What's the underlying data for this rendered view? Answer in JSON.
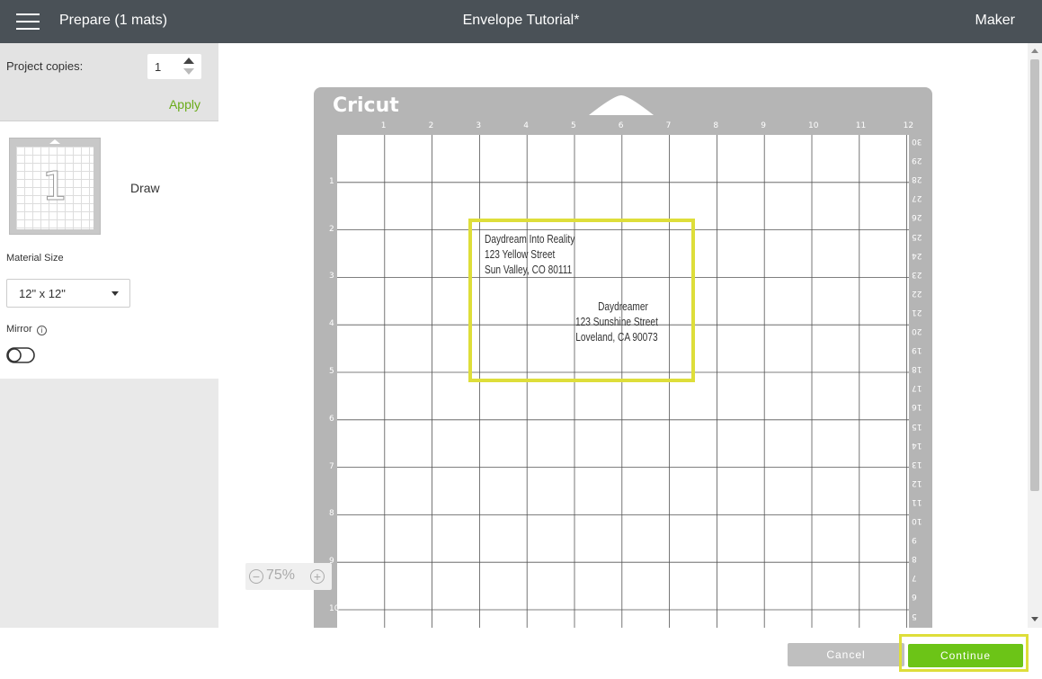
{
  "header": {
    "prepare": "Prepare (1 mats)",
    "project_title": "Envelope Tutorial*",
    "machine": "Maker"
  },
  "sidebar": {
    "copies_label": "Project copies:",
    "copies_value": "1",
    "apply": "Apply",
    "mat_number": "1",
    "mat_mode": "Draw",
    "material_size_label": "Material Size",
    "material_size_value": "12\" x 12\"",
    "mirror_label": "Mirror",
    "mirror_info_glyph": "i",
    "mirror_on": false
  },
  "mat": {
    "brand": "Cricut",
    "top_ruler": [
      "1",
      "2",
      "3",
      "4",
      "5",
      "6",
      "7",
      "8",
      "9",
      "10",
      "11",
      "12"
    ],
    "left_ruler": [
      "1",
      "2",
      "3",
      "4",
      "5",
      "6",
      "7",
      "8",
      "9",
      "10"
    ],
    "right_ruler": [
      "30",
      "29",
      "28",
      "27",
      "26",
      "25",
      "24",
      "23",
      "22",
      "21",
      "20",
      "19",
      "18",
      "17",
      "16",
      "15",
      "14",
      "13",
      "12",
      "11",
      "10",
      "9",
      "8",
      "7",
      "6",
      "5"
    ],
    "return_address": [
      "Daydream Into Reality",
      "123 Yellow Street",
      "Sun Valley, CO 80111"
    ],
    "recipient_address": [
      "Daydreamer",
      "123 Sunshine Street",
      "Loveland, CA 90073"
    ]
  },
  "zoom": {
    "minus": "−",
    "value": "75%",
    "plus": "+"
  },
  "footer": {
    "cancel": "Cancel",
    "continue": "Continue"
  },
  "colors": {
    "header": "#4a5157",
    "accent_green": "#6cc417",
    "highlight": "#dede3a",
    "mat": "#b5b5b5"
  }
}
